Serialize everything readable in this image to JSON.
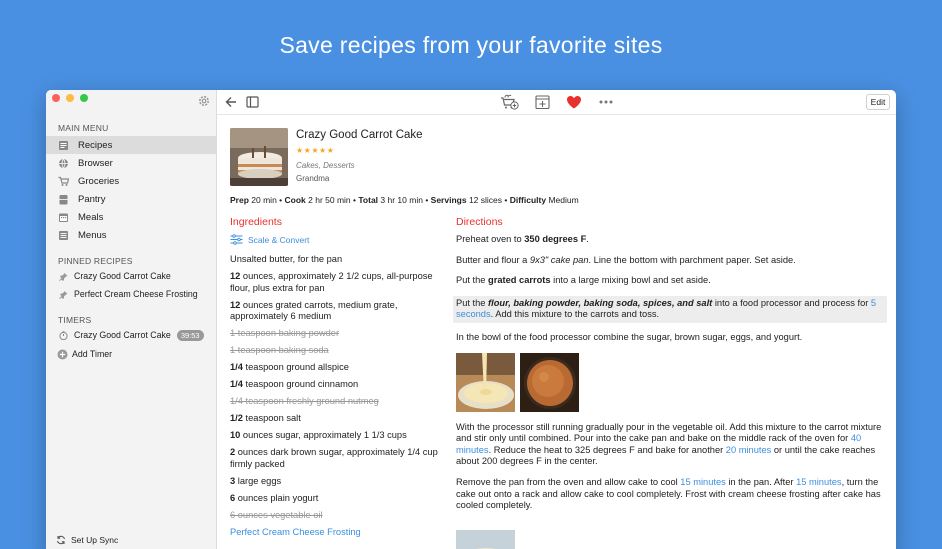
{
  "headline": "Save recipes from your favorite sites",
  "sidebar": {
    "main_menu_title": "MAIN MENU",
    "items": [
      {
        "label": "Recipes",
        "icon": "recipes-icon",
        "active": true
      },
      {
        "label": "Browser",
        "icon": "globe-icon"
      },
      {
        "label": "Groceries",
        "icon": "cart-icon"
      },
      {
        "label": "Pantry",
        "icon": "pantry-icon"
      },
      {
        "label": "Meals",
        "icon": "calendar-icon"
      },
      {
        "label": "Menus",
        "icon": "menus-icon"
      }
    ],
    "pinned_title": "PINNED RECIPES",
    "pinned": [
      {
        "label": "Crazy Good Carrot Cake"
      },
      {
        "label": "Perfect Cream Cheese Frosting"
      }
    ],
    "timers_title": "TIMERS",
    "timers": [
      {
        "label": "Crazy Good Carrot Cake",
        "time": "39:53"
      }
    ],
    "add_timer": "Add Timer",
    "sync": "Set Up Sync"
  },
  "toolbar": {
    "edit_label": "Edit"
  },
  "recipe": {
    "title": "Crazy Good Carrot Cake",
    "stars": "★★★★★",
    "categories": "Cakes, Desserts",
    "source": "Grandma",
    "meta": {
      "prep_label": "Prep",
      "prep": "20 min",
      "cook_label": "Cook",
      "cook": "2 hr 50 min",
      "total_label": "Total",
      "total": "3 hr 10 min",
      "servings_label": "Servings",
      "servings": "12 slices",
      "difficulty_label": "Difficulty",
      "difficulty": "Medium"
    },
    "ingredients_heading": "Ingredients",
    "scale_label": "Scale & Convert",
    "ingredients": [
      {
        "qty": "",
        "text": "Unsalted butter, for the pan"
      },
      {
        "qty": "12",
        "text": " ounces, approximately 2 1/2 cups, all-purpose flour, plus extra for pan"
      },
      {
        "qty": "12",
        "text": " ounces grated carrots, medium grate, approximately 6 medium"
      },
      {
        "qty": "",
        "text": "1 teaspoon baking powder",
        "struck": true
      },
      {
        "qty": "",
        "text": "1 teaspoon baking soda",
        "struck": true
      },
      {
        "qty": "1/4",
        "text": " teaspoon ground allspice"
      },
      {
        "qty": "1/4",
        "text": " teaspoon ground cinnamon"
      },
      {
        "qty": "",
        "text": "1/4 teaspoon freshly ground nutmeg",
        "struck": true
      },
      {
        "qty": "1/2",
        "text": " teaspoon salt"
      },
      {
        "qty": "10",
        "text": " ounces sugar, approximately 1 1/3 cups"
      },
      {
        "qty": "2",
        "text": " ounces dark brown sugar, approximately 1/4 cup firmly packed"
      },
      {
        "qty": "3",
        "text": " large eggs"
      },
      {
        "qty": "6",
        "text": " ounces plain yogurt"
      },
      {
        "qty": "",
        "text": "6 ounces vegetable oil",
        "struck": true
      },
      {
        "qty": "",
        "text": "Perfect Cream Cheese Frosting",
        "link": true
      }
    ],
    "directions_heading": "Directions",
    "directions": {
      "s1_a": "Preheat oven to ",
      "s1_b": "350 degrees F",
      "s1_c": ".",
      "s2_a": "Butter and flour a ",
      "s2_b": "9x3\" cake pan",
      "s2_c": ". Line the bottom with parchment paper. Set aside.",
      "s3_a": "Put the ",
      "s3_b": "grated carrots",
      "s3_c": " into a large mixing bowl and set aside.",
      "s4_a": "Put the ",
      "s4_b": "flour, baking powder, baking soda, spices, and salt",
      "s4_c": " into a food processor and process for ",
      "s4_d": "5 seconds",
      "s4_e": ". Add this mixture to the carrots and toss.",
      "s5": "In the bowl of the food processor combine the sugar, brown sugar, eggs, and yogurt.",
      "s6_a": "With the processor still running gradually pour in the vegetable oil. Add this mixture to the carrot mixture and stir only until combined. Pour into the cake pan and bake on the middle rack of the oven for ",
      "s6_b": "40 minutes",
      "s6_c": ". Reduce the heat to 325 degrees F and bake for another ",
      "s6_d": "20 minutes",
      "s6_e": " or until the cake reaches about 200 degrees F in the center.",
      "s7_a": "Remove the pan from the oven and allow cake to cool ",
      "s7_b": "15 minutes",
      "s7_c": " in the pan. After ",
      "s7_d": "15 minutes",
      "s7_e": ", turn the cake out onto a rack and allow cake to cool completely. Frost with cream cheese frosting after cake has cooled completely."
    }
  },
  "colors": {
    "background": "#4a90e2",
    "accent_red": "#e8312f",
    "link_blue": "#3b8ee0",
    "star": "#f5a623"
  }
}
